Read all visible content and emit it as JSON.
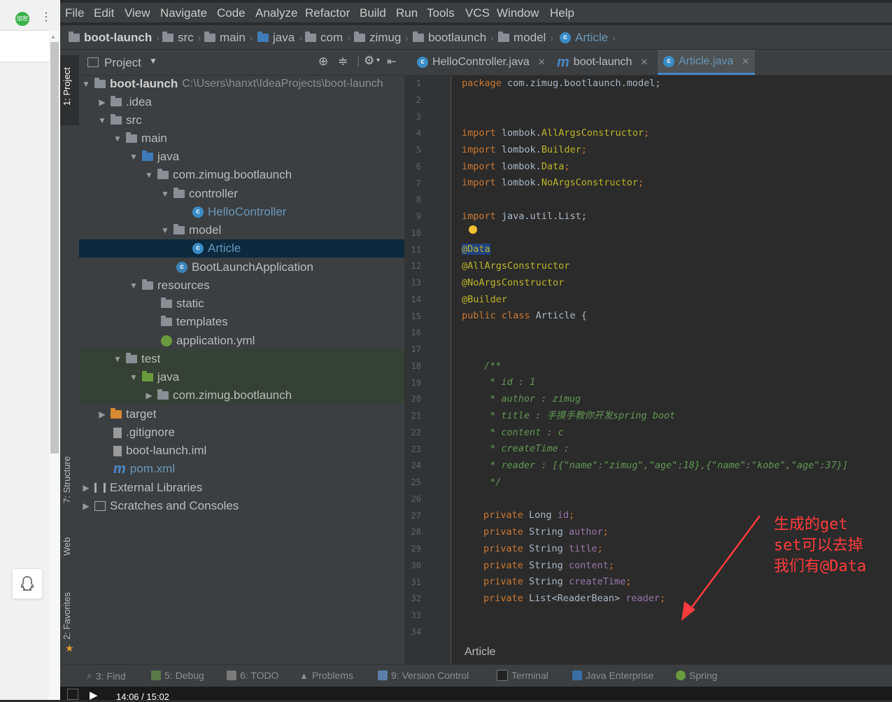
{
  "menu": {
    "items": [
      "File",
      "Edit",
      "View",
      "Navigate",
      "Code",
      "Analyze",
      "Refactor",
      "Build",
      "Run",
      "Tools",
      "VCS",
      "Window",
      "Help"
    ]
  },
  "breadcrumb": [
    "boot-launch",
    "src",
    "main",
    "java",
    "com",
    "zimug",
    "bootlaunch",
    "model",
    "Article"
  ],
  "project_panel": {
    "title": "Project",
    "root": {
      "name": "boot-launch",
      "path": "C:\\Users\\hanxt\\IdeaProjects\\boot-launch"
    },
    "nodes": [
      {
        "label": ".idea"
      },
      {
        "label": "src"
      },
      {
        "label": "main"
      },
      {
        "label": "java"
      },
      {
        "label": "com.zimug.bootlaunch"
      },
      {
        "label": "controller"
      },
      {
        "label": "HelloController"
      },
      {
        "label": "model"
      },
      {
        "label": "Article"
      },
      {
        "label": "BootLaunchApplication"
      },
      {
        "label": "resources"
      },
      {
        "label": "static"
      },
      {
        "label": "templates"
      },
      {
        "label": "application.yml"
      },
      {
        "label": "test"
      },
      {
        "label": "java"
      },
      {
        "label": "com.zimug.bootlaunch"
      },
      {
        "label": "target"
      },
      {
        "label": ".gitignore"
      },
      {
        "label": "boot-launch.iml"
      },
      {
        "label": "pom.xml"
      },
      {
        "label": "External Libraries"
      },
      {
        "label": "Scratches and Consoles"
      }
    ]
  },
  "side_tools": [
    "1: Project",
    "7: Structure",
    "Web",
    "2: Favorites"
  ],
  "editor": {
    "tabs": [
      {
        "label": "HelloController.java"
      },
      {
        "label": "boot-launch"
      },
      {
        "label": "Article.java"
      }
    ],
    "line_numbers": [
      "1",
      "2",
      "3",
      "4",
      "5",
      "6",
      "7",
      "8",
      "9",
      "10",
      "11",
      "12",
      "13",
      "14",
      "15",
      "16",
      "17",
      "18",
      "19",
      "20",
      "21",
      "22",
      "23",
      "24",
      "25",
      "26",
      "27",
      "28",
      "29",
      "30",
      "31",
      "32",
      "33",
      "34"
    ],
    "code": {
      "l1": [
        "package",
        " com.zimug.bootlaunch.model;"
      ],
      "l4": [
        "import",
        " lombok.",
        "AllArgsConstructor",
        ";"
      ],
      "l5": [
        "import",
        " lombok.",
        "Builder",
        ";"
      ],
      "l6": [
        "import",
        " lombok.",
        "Data",
        ";"
      ],
      "l7": [
        "import",
        " lombok.",
        "NoArgsConstructor",
        ";"
      ],
      "l9": [
        "import",
        " java.util.List;"
      ],
      "l11": "@Data",
      "l12": "@AllArgsConstructor",
      "l13": "@NoArgsConstructor",
      "l14": "@Builder",
      "l15": [
        "public class",
        " Article {"
      ],
      "l18": "/**",
      "l19": " * id : 1",
      "l20": " * author : zimug",
      "l21": " * title : 手摸手教你开发spring boot",
      "l22": " * content : c",
      "l23": " * createTime : ",
      "l24": " * reader : [{\"name\":\"zimug\",\"age\":18},{\"name\":\"kobe\",\"age\":37}]",
      "l25": " */",
      "fields": [
        {
          "mod": "private",
          "type": " Long ",
          "name": "id",
          "end": ";"
        },
        {
          "mod": "private",
          "type": " String ",
          "name": "author",
          "end": ";"
        },
        {
          "mod": "private",
          "type": " String ",
          "name": "title",
          "end": ";"
        },
        {
          "mod": "private",
          "type": " String ",
          "name": "content",
          "end": ";"
        },
        {
          "mod": "private",
          "type": " String ",
          "name": "createTime",
          "end": ";"
        },
        {
          "mod": "private",
          "type": " List<ReaderBean> ",
          "name": "reader",
          "end": ";"
        }
      ]
    },
    "annotation_note": "生成的get\nset可以去掉\n我们有@Data",
    "status_crumb": "Article"
  },
  "bottom_tools": [
    {
      "label": "3: Find"
    },
    {
      "label": "5: Debug"
    },
    {
      "label": "6: TODO"
    },
    {
      "label": "Problems"
    },
    {
      "label": "9: Version Control"
    },
    {
      "label": "Terminal"
    },
    {
      "label": "Java Enterprise"
    },
    {
      "label": "Spring"
    }
  ],
  "browser": {
    "ext_badge": "加密"
  },
  "player": {
    "time": "14:06 / 15:02"
  },
  "colors": {
    "accent": "#4a88c7",
    "annotation_red": "#ff3b3b",
    "selection": "#0d293e"
  }
}
